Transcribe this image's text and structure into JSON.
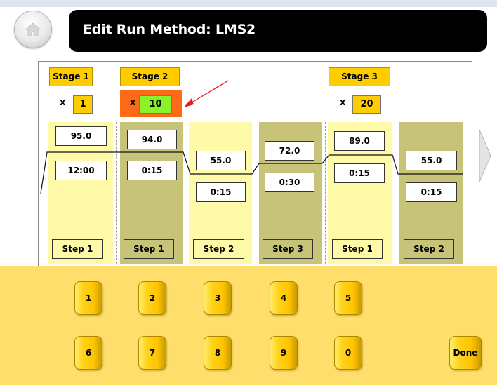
{
  "header": {
    "title": "Edit Run Method: LMS2"
  },
  "stages": [
    {
      "label": "Stage 1",
      "times_symbol": "x",
      "repeat": "1"
    },
    {
      "label": "Stage 2",
      "times_symbol": "x",
      "repeat": "10",
      "selected": true
    },
    {
      "label": "Stage 3",
      "times_symbol": "x",
      "repeat": "20"
    }
  ],
  "steps": [
    {
      "stage": "Stage 1",
      "temp": "95.0",
      "time": "12:00",
      "label": "Step 1"
    },
    {
      "stage": "Stage 2",
      "temp": "94.0",
      "time": "0:15",
      "label": "Step 1"
    },
    {
      "stage": "Stage 2",
      "temp": "55.0",
      "time": "0:15",
      "label": "Step 2"
    },
    {
      "stage": "Stage 2",
      "temp": "72.0",
      "time": "0:30",
      "label": "Step 3"
    },
    {
      "stage": "Stage 3",
      "temp": "89.0",
      "time": "0:15",
      "label": "Step 1"
    },
    {
      "stage": "Stage 3",
      "temp": "55.0",
      "time": "0:15",
      "label": "Step 2"
    }
  ],
  "keypad": {
    "keys": [
      "1",
      "2",
      "3",
      "4",
      "5",
      "6",
      "7",
      "8",
      "9",
      "0"
    ],
    "done_label": "Done"
  },
  "colors": {
    "stage_label": "#ffcc00",
    "selected_repeat_bg": "#ff6a19",
    "selected_repeat_field": "#88f22a",
    "step_light": "#fffaa8",
    "step_dark": "#c7c47a",
    "keypad_bg": "#ffde6b"
  }
}
